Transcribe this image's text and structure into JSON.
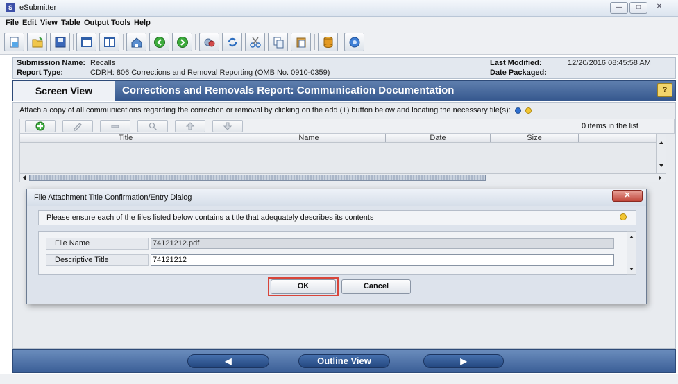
{
  "window": {
    "title": "eSubmitter",
    "app_icon_letter": "S",
    "minimize_glyph": "—",
    "maximize_glyph": "□",
    "close_glyph": "✕"
  },
  "menu": [
    "File",
    "Edit",
    "View",
    "Table",
    "Output",
    "Tools",
    "Help"
  ],
  "toolbar": {
    "icons": [
      "new-document-icon",
      "open-folder-icon",
      "save-icon",
      "single-pane-icon",
      "split-pane-icon",
      "home-icon",
      "back-arrow-icon",
      "forward-arrow-icon",
      "validate-icon",
      "refresh-icon",
      "cut-icon",
      "copy-icon",
      "paste-icon",
      "package-icon",
      "help-icon"
    ]
  },
  "header": {
    "submission_name_label": "Submission Name:",
    "submission_name": "Recalls",
    "report_type_label": "Report Type:",
    "report_type": "CDRH: 806 Corrections and Removal Reporting (OMB No. 0910-0359)",
    "last_modified_label": "Last Modified:",
    "last_modified": "12/20/2016 08:45:58 AM",
    "date_packaged_label": "Date Packaged:",
    "date_packaged": ""
  },
  "section": {
    "view_tab": "Screen View",
    "title": "Corrections and Removals Report: Communication Documentation",
    "help_label": "?"
  },
  "attachments": {
    "instruction": "Attach a copy of all communications regarding the correction or removal by clicking on the add (+) button below and locating the necessary file(s):",
    "item_count": "0 items in the list",
    "list_buttons": [
      "add-icon",
      "edit-icon",
      "remove-icon",
      "view-icon",
      "move-up-icon",
      "move-down-icon"
    ],
    "columns": [
      "Title",
      "Name",
      "Date",
      "Size"
    ],
    "rows": []
  },
  "dialog": {
    "title": "File Attachment Title Confirmation/Entry Dialog",
    "message": "Please ensure each of the files listed below contains a title that adequately describes its contents",
    "file_name_label": "File Name",
    "file_name": "74121212.pdf",
    "descriptive_title_label": "Descriptive Title",
    "descriptive_title": "74121212",
    "ok_label": "OK",
    "cancel_label": "Cancel",
    "close_glyph": "✕"
  },
  "nav": {
    "prev_glyph": "◀",
    "outline_label": "Outline View",
    "next_glyph": "▶"
  }
}
